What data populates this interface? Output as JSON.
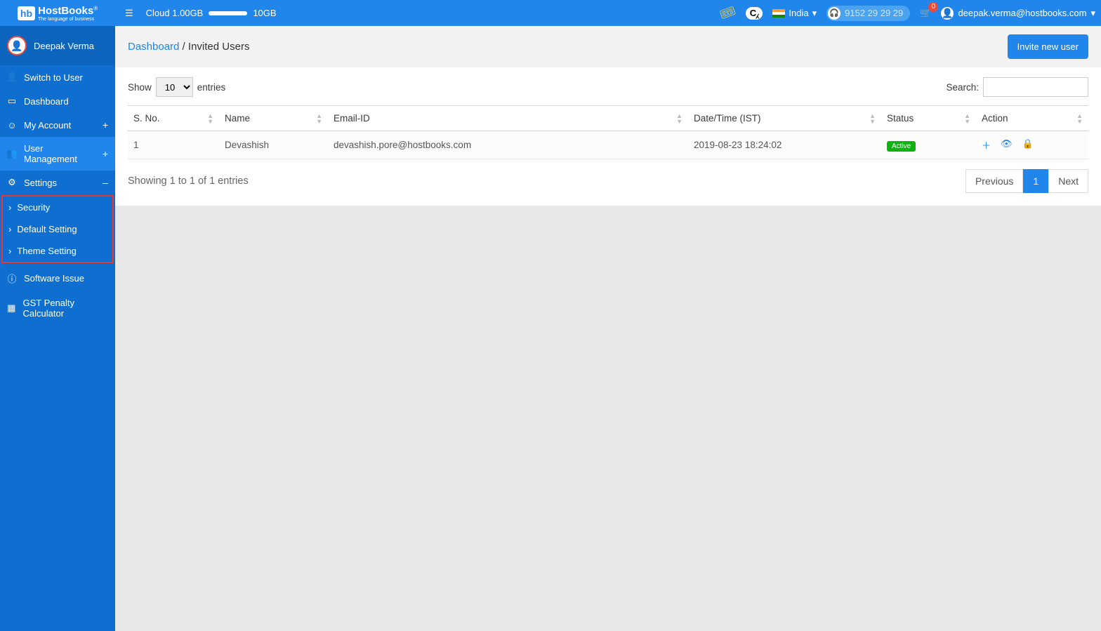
{
  "header": {
    "brand_short": "hb",
    "brand_name": "HostBooks",
    "brand_tag": "The language of business",
    "cloud_used": "Cloud 1.00GB",
    "cloud_total": "10GB",
    "country": "India",
    "phone": "9152 29 29 29",
    "cart_count": "0",
    "user_email": "deepak.verma@hostbooks.com"
  },
  "sidebar": {
    "username": "Deepak Verma",
    "items": {
      "switch": "Switch to User",
      "dashboard": "Dashboard",
      "account": "My Account",
      "user_mgmt": "User Management",
      "settings": "Settings",
      "security": "Security",
      "default_setting": "Default Setting",
      "theme_setting": "Theme Setting",
      "software_issue": "Software Issue",
      "gst_calc": "GST Penalty Calculator"
    }
  },
  "breadcrumb": {
    "root": "Dashboard",
    "current": "Invited Users",
    "invite_btn": "Invite new user"
  },
  "table": {
    "show_label": "Show",
    "show_value": "10",
    "entries_label": "entries",
    "search_label": "Search:",
    "columns": {
      "sno": "S. No.",
      "name": "Name",
      "email": "Email-ID",
      "datetime": "Date/Time (IST)",
      "status": "Status",
      "action": "Action"
    },
    "rows": [
      {
        "sno": "1",
        "name": "Devashish",
        "email": "devashish.pore@hostbooks.com",
        "datetime": "2019-08-23 18:24:02",
        "status": "Active"
      }
    ],
    "footer_info": "Showing 1 to 1 of 1 entries",
    "pager_prev": "Previous",
    "pager_page": "1",
    "pager_next": "Next"
  }
}
